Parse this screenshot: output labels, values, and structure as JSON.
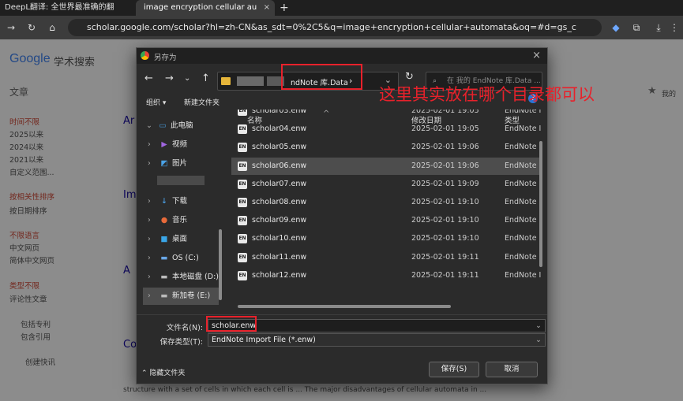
{
  "tabs": [
    {
      "label": "DeepL翻译: 全世界最准确的翻"
    },
    {
      "label": "image encryption cellular au"
    }
  ],
  "url": "scholar.google.com/scholar?hl=zh-CN&as_sdt=0%2C5&q=image+encryption+cellular+automata&oq=#d=gs_cit&t=173...",
  "google": {
    "logo": "Google",
    "product": "学术搜索",
    "right_label": "我的"
  },
  "sidebar": {
    "heading": "文章",
    "time": [
      "时间不限",
      "2025以来",
      "2024以来",
      "2021以来",
      "自定义范围..."
    ],
    "sort": [
      "按相关性排序",
      "按日期排序"
    ],
    "lang": [
      "不限语言",
      "中文网页",
      "简体中文网页"
    ],
    "type": [
      "类型不限",
      "评论性文章"
    ],
    "checks": [
      "包括专利",
      "包含引用"
    ],
    "alert": "创建快讯"
  },
  "result_snippet": "structure with a set of cells in which each cell is ... The major disadvantages of cellular automata in ...",
  "dialog": {
    "title": "另存为",
    "path_tail": "ndNote 库.Data",
    "search_placeholder": "在 我的 EndNote 库.Data ...",
    "organize": "组织",
    "new_folder": "新建文件夹",
    "tree": [
      {
        "label": "此电脑",
        "icon": "pc-icon"
      },
      {
        "label": "视频",
        "icon": "video-icon"
      },
      {
        "label": "图片",
        "icon": "pictures-icon"
      },
      {
        "label": "下载",
        "icon": "download-icon"
      },
      {
        "label": "音乐",
        "icon": "music-icon"
      },
      {
        "label": "桌面",
        "icon": "desktop-icon"
      },
      {
        "label": "OS (C:)",
        "icon": "drive-icon"
      },
      {
        "label": "本地磁盘 (D:)",
        "icon": "drive-icon"
      },
      {
        "label": "新加卷 (E:)",
        "icon": "drive-icon"
      }
    ],
    "columns": {
      "name": "名称",
      "date": "修改日期",
      "type": "类型"
    },
    "files": [
      {
        "name": "scholar03.enw",
        "date": "2025-02-01 19:05",
        "type": "EndNote I"
      },
      {
        "name": "scholar04.enw",
        "date": "2025-02-01 19:05",
        "type": "EndNote I"
      },
      {
        "name": "scholar05.enw",
        "date": "2025-02-01 19:06",
        "type": "EndNote I"
      },
      {
        "name": "scholar06.enw",
        "date": "2025-02-01 19:06",
        "type": "EndNote I"
      },
      {
        "name": "scholar07.enw",
        "date": "2025-02-01 19:09",
        "type": "EndNote I"
      },
      {
        "name": "scholar08.enw",
        "date": "2025-02-01 19:10",
        "type": "EndNote I"
      },
      {
        "name": "scholar09.enw",
        "date": "2025-02-01 19:10",
        "type": "EndNote I"
      },
      {
        "name": "scholar10.enw",
        "date": "2025-02-01 19:10",
        "type": "EndNote I"
      },
      {
        "name": "scholar11.enw",
        "date": "2025-02-01 19:11",
        "type": "EndNote I"
      },
      {
        "name": "scholar12.enw",
        "date": "2025-02-01 19:11",
        "type": "EndNote I"
      }
    ],
    "filename_label": "文件名(N):",
    "filename_value": "scholar.enw",
    "filetype_label": "保存类型(T):",
    "filetype_value": "EndNote Import File (*.enw)",
    "hide_folders": "隐藏文件夹",
    "save": "保存(S)",
    "cancel": "取消"
  },
  "annotation": "这里其实放在哪个目录都可以",
  "colors": {
    "annotation": "#e8212b",
    "accent": "#4285f4"
  }
}
